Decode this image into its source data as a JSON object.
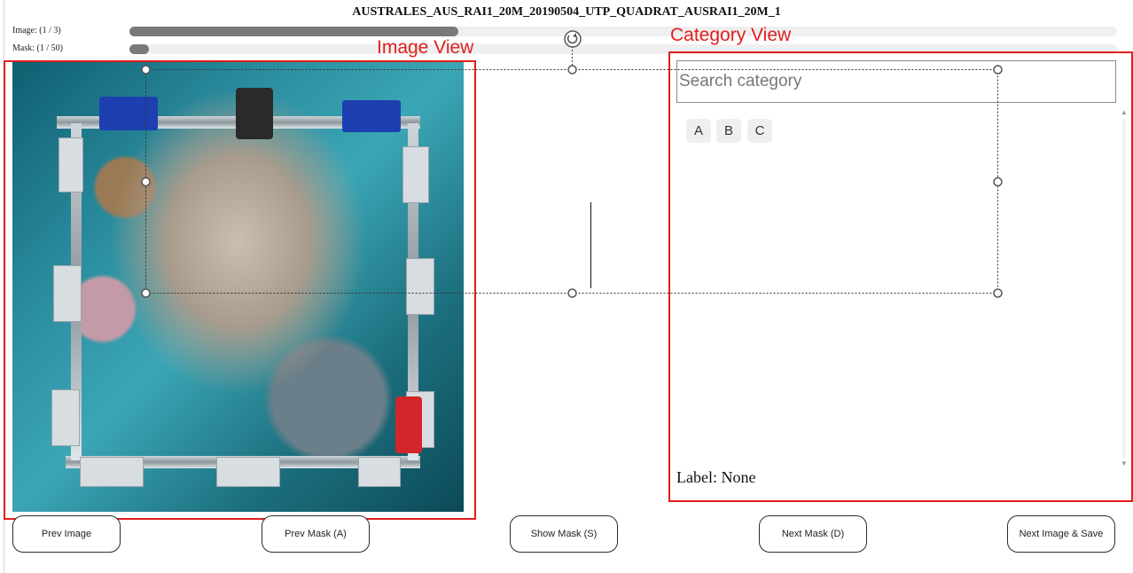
{
  "header": {
    "title": "AUSTRALES_AUS_RAI1_20M_20190504_UTP_QUADRAT_AUSRAI1_20M_1"
  },
  "progress": {
    "image_label": "Image: (1 / 3)",
    "image_fraction": 0.333,
    "mask_label": "Mask: (1 / 50)",
    "mask_fraction": 0.02
  },
  "annotations": {
    "image_view_title": "Image View",
    "category_view_title": "Category View"
  },
  "category": {
    "search_placeholder": "Search category",
    "search_value": "",
    "chips": [
      "A",
      "B",
      "C"
    ],
    "label_text": "Label: None"
  },
  "buttons": {
    "prev_image": "Prev Image",
    "prev_mask": "Prev Mask (A)",
    "show_mask": "Show Mask (S)",
    "next_mask": "Next Mask (D)",
    "next_image_save": "Next Image & Save"
  },
  "icons": {
    "rotate": "rotate-handle-icon",
    "scroll_up": "chevron-up-icon",
    "scroll_down": "chevron-down-icon"
  },
  "colors": {
    "annotation_red": "#e01e1e",
    "progress_fill": "#7a7a7a",
    "progress_track": "#efefef"
  }
}
